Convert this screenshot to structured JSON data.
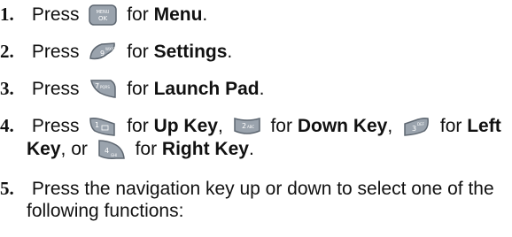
{
  "steps": [
    {
      "num": "1.",
      "press": "Press",
      "for": "for",
      "target": "Menu",
      "key": "MENU OK",
      "end": "."
    },
    {
      "num": "2.",
      "press": "Press",
      "for": "for",
      "target": "Settings",
      "key": "9 WXYZ",
      "end": "."
    },
    {
      "num": "3.",
      "press": "Press",
      "for": "for",
      "target": "Launch Pad",
      "key": "7 PQRS",
      "end": "."
    },
    {
      "num": "4.",
      "press": "Press",
      "parts": [
        {
          "key": "1",
          "for": "for",
          "target": "Up Key",
          "sep": ","
        },
        {
          "key": "2 ABC",
          "for": "for",
          "target": "Down Key",
          "sep": ","
        },
        {
          "key": "3 DEF",
          "for": "for",
          "target_a": "Left",
          "target_b": "Key",
          "sep": ", or"
        },
        {
          "key": "4 GHI",
          "for": "for",
          "target": "Right Key",
          "sep": "."
        }
      ]
    },
    {
      "num": "5.",
      "line1": "Press the navigation key up or down to select one of the",
      "line2": "following functions:"
    }
  ],
  "colors": {
    "key_fill": "#9aa3ad",
    "key_dark": "#5d6670",
    "text": "#111111"
  }
}
